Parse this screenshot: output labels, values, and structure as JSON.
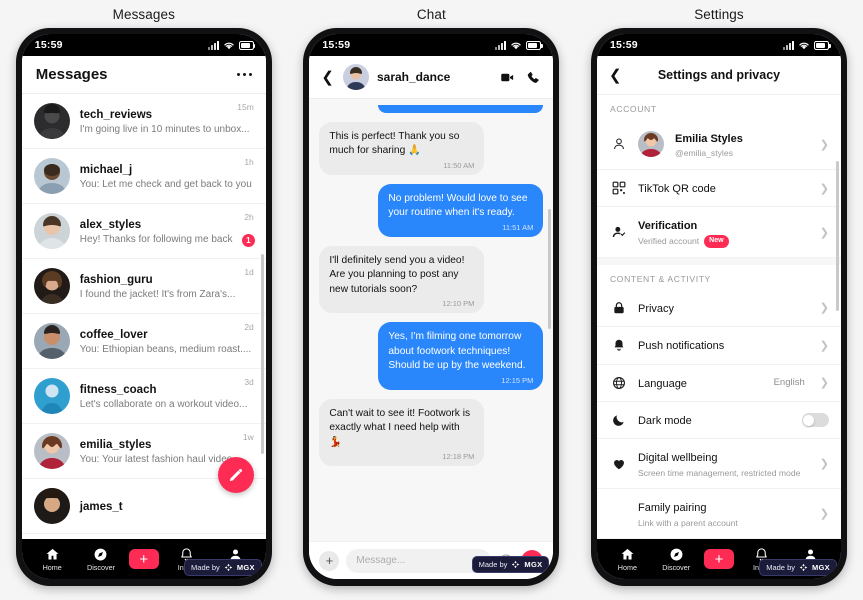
{
  "panels": [
    {
      "title": "Messages"
    },
    {
      "title": "Chat"
    },
    {
      "title": "Settings"
    }
  ],
  "status_bar": {
    "time": "15:59"
  },
  "colors": {
    "accent": "#fe2c55",
    "bubble_out": "#2a86fb",
    "nav_bg": "#000000"
  },
  "messages": {
    "header_title": "Messages",
    "more_icon": "more-options-icon",
    "rows": [
      {
        "name": "tech_reviews",
        "preview": "I'm going live in 10 minutes to unbox...",
        "time": "15m",
        "unread": ""
      },
      {
        "name": "michael_j",
        "preview": "You: Let me check and get back to you",
        "time": "1h",
        "unread": ""
      },
      {
        "name": "alex_styles",
        "preview": "Hey! Thanks for following me back",
        "time": "2h",
        "unread": "1"
      },
      {
        "name": "fashion_guru",
        "preview": "I found the jacket! It's from Zara's...",
        "time": "1d",
        "unread": ""
      },
      {
        "name": "coffee_lover",
        "preview": "You: Ethiopian beans, medium roast....",
        "time": "2d",
        "unread": ""
      },
      {
        "name": "fitness_coach",
        "preview": "Let's collaborate on a workout video...",
        "time": "3d",
        "unread": ""
      },
      {
        "name": "emilia_styles",
        "preview": "You: Your latest fashion haul video...",
        "time": "1w",
        "unread": ""
      },
      {
        "name": "james_t",
        "preview": "",
        "time": "",
        "unread": ""
      }
    ],
    "compose_icon": "pencil-compose-icon"
  },
  "chat": {
    "contact": "sarah_dance",
    "back_icon": "chevron-left-icon",
    "video_icon": "video-camera-icon",
    "call_icon": "phone-icon",
    "bubbles": [
      {
        "kind": "out-clipped",
        "text": "",
        "time": ""
      },
      {
        "kind": "in",
        "text": "This is perfect! Thank you so much for sharing 🙏",
        "time": "11:50 AM"
      },
      {
        "kind": "out",
        "text": "No problem! Would love to see your routine when it's ready.",
        "time": "11:51 AM"
      },
      {
        "kind": "in",
        "text": "I'll definitely send you a video! Are you planning to post any new tutorials soon?",
        "time": "12:10 PM"
      },
      {
        "kind": "out",
        "text": "Yes, I'm filming one tomorrow about footwork techniques! Should be up by the weekend.",
        "time": "12:15 PM"
      },
      {
        "kind": "in",
        "text": "Can't wait to see it! Footwork is exactly what I need help with 💃",
        "time": "12:18 PM"
      }
    ],
    "input_placeholder": "Message...",
    "plus_icon": "plus-attach-icon",
    "emoji_icon": "emoji-icon",
    "send_icon": "send-icon"
  },
  "settings": {
    "header_title": "Settings and privacy",
    "back_icon": "chevron-left-icon",
    "sections": [
      {
        "label": "ACCOUNT",
        "rows": [
          {
            "icon": "person-icon",
            "avatar": true,
            "title": "Emilia Styles",
            "subtitle": "@emilia_styles",
            "value": "",
            "badge": "",
            "control": "chevron"
          },
          {
            "icon": "qr-code-icon",
            "avatar": false,
            "title": "TikTok QR code",
            "subtitle": "",
            "value": "",
            "badge": "",
            "control": "chevron"
          },
          {
            "icon": "verified-person-icon",
            "avatar": false,
            "title": "Verification",
            "subtitle": "Verified account",
            "value": "",
            "badge": "New",
            "control": "chevron"
          }
        ]
      },
      {
        "label": "CONTENT & ACTIVITY",
        "rows": [
          {
            "icon": "lock-icon",
            "avatar": false,
            "title": "Privacy",
            "subtitle": "",
            "value": "",
            "badge": "",
            "control": "chevron"
          },
          {
            "icon": "bell-icon",
            "avatar": false,
            "title": "Push notifications",
            "subtitle": "",
            "value": "",
            "badge": "",
            "control": "chevron"
          },
          {
            "icon": "globe-icon",
            "avatar": false,
            "title": "Language",
            "subtitle": "",
            "value": "English",
            "badge": "",
            "control": "chevron"
          },
          {
            "icon": "moon-icon",
            "avatar": false,
            "title": "Dark mode",
            "subtitle": "",
            "value": "",
            "badge": "",
            "control": "toggle"
          },
          {
            "icon": "heart-icon",
            "avatar": false,
            "title": "Digital wellbeing",
            "subtitle": "Screen time management, restricted mode",
            "value": "",
            "badge": "",
            "control": "chevron"
          },
          {
            "icon": "",
            "avatar": false,
            "title": "Family pairing",
            "subtitle": "Link with a parent account",
            "value": "",
            "badge": "",
            "control": "chevron"
          }
        ]
      }
    ]
  },
  "bottom_nav": {
    "items": [
      {
        "label": "Home",
        "icon": "home-icon"
      },
      {
        "label": "Discover",
        "icon": "compass-icon"
      },
      {
        "label": "",
        "icon": "plus-icon"
      },
      {
        "label": "Inbox",
        "icon": "bell-icon"
      },
      {
        "label": "Me",
        "icon": "person-icon"
      }
    ]
  },
  "watermark": {
    "made_by": "Made by",
    "brand": "MGX",
    "icon": "mgx-logo-icon"
  }
}
